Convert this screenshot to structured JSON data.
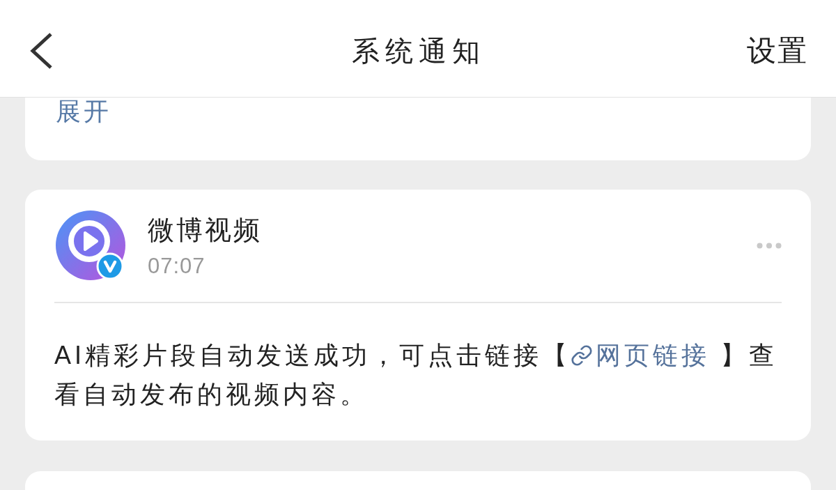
{
  "header": {
    "title": "系统通知",
    "action": "设置"
  },
  "previous_card": {
    "expand_link": "展开"
  },
  "notification": {
    "sender": "微博视频",
    "verified": true,
    "time": "07:07",
    "body": [
      {
        "kind": "text",
        "text": "AI精彩片段自动发送成功，可点击链接【"
      },
      {
        "kind": "link",
        "text": "网页链接"
      },
      {
        "kind": "text",
        "text": " 】查看自动发布的视频内容。"
      }
    ]
  }
}
